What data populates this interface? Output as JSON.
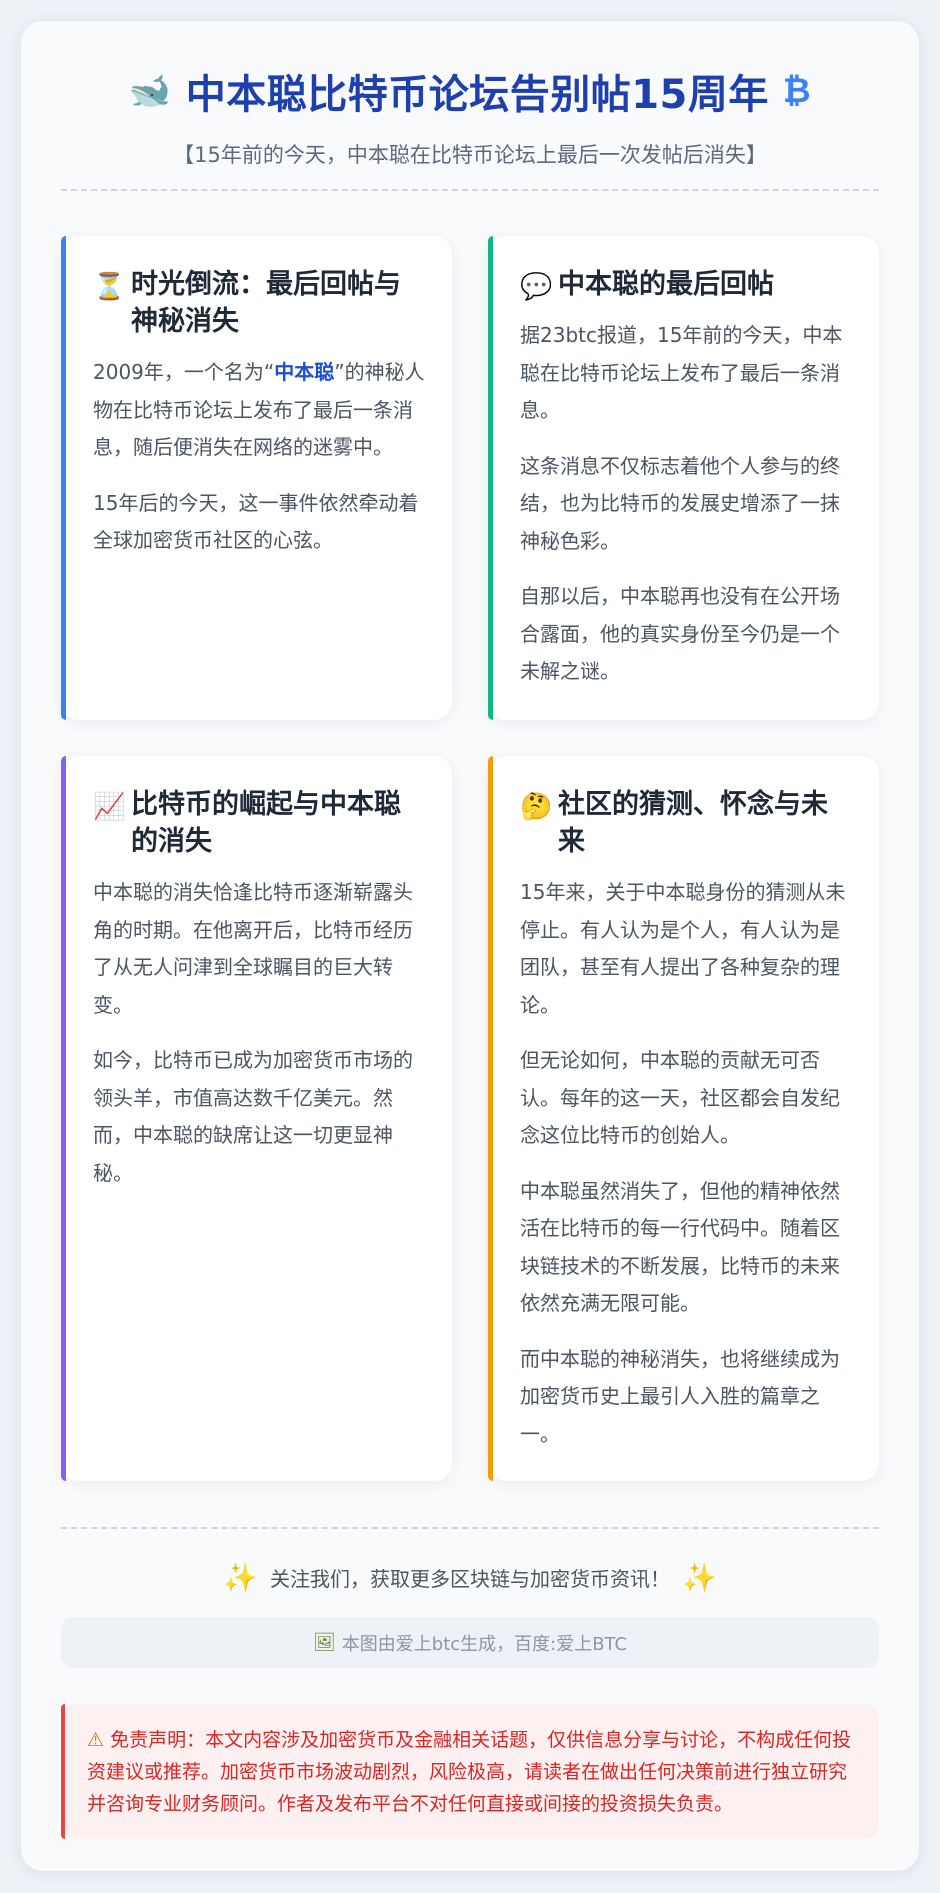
{
  "header": {
    "icon_left": "🐋",
    "icon_right": "₿",
    "title": "中本聪比特币论坛告别帖15周年",
    "subtitle": "【15年前的今天，中本聪在比特币论坛上最后一次发帖后消失】"
  },
  "cards": [
    {
      "icon": "⏳",
      "title": "时光倒流：最后回帖与神秘消失",
      "p1_pre": "2009年，一个名为“",
      "p1_hl": "中本聪",
      "p1_post": "”的神秘人物在比特币论坛上发布了最后一条消息，随后便消失在网络的迷雾中。",
      "p2": "15年后的今天，这一事件依然牵动着全球加密货币社区的心弦。"
    },
    {
      "icon": "💬",
      "title": "中本聪的最后回帖",
      "p1": "据23btc报道，15年前的今天，中本聪在比特币论坛上发布了最后一条消息。",
      "p2": "这条消息不仅标志着他个人参与的终结，也为比特币的发展史增添了一抹神秘色彩。",
      "p3": "自那以后，中本聪再也没有在公开场合露面，他的真实身份至今仍是一个未解之谜。"
    },
    {
      "icon": "📈",
      "title": "比特币的崛起与中本聪的消失",
      "p1": "中本聪的消失恰逢比特币逐渐崭露头角的时期。在他离开后，比特币经历了从无人问津到全球瞩目的巨大转变。",
      "p2": "如今，比特币已成为加密货币市场的领头羊，市值高达数千亿美元。然而，中本聪的缺席让这一切更显神秘。"
    },
    {
      "icon": "🤔",
      "title": "社区的猜测、怀念与未来",
      "p1": "15年来，关于中本聪身份的猜测从未停止。有人认为是个人，有人认为是团队，甚至有人提出了各种复杂的理论。",
      "p2": "但无论如何，中本聪的贡献无可否认。每年的这一天，社区都会自发纪念这位比特币的创始人。",
      "p3": "中本聪虽然消失了，但他的精神依然活在比特币的每一行代码中。随着区块链技术的不断发展，比特币的未来依然充满无限可能。",
      "p4": "而中本聪的神秘消失，也将继续成为加密货币史上最引人入胜的篇章之一。"
    }
  ],
  "footer": {
    "spark_icon": "✨",
    "follow": "关注我们，获取更多区块链与加密货币资讯！",
    "gen_icon": "🖼",
    "generated": "本图由爱上btc生成，百度:爱上BTC",
    "warn_icon": "⚠",
    "disclaimer": "免责声明：本文内容涉及加密货币及金融相关话题，仅供信息分享与讨论，不构成任何投资建议或推荐。加密货币市场波动剧烈，风险极高，请读者在做出任何决策前进行独立研究并咨询专业财务顾问。作者及发布平台不对任何直接或间接的投资损失负责。"
  },
  "colors": {
    "title": "#1e40af",
    "card1_accent": "#3b82f6",
    "card2_accent": "#10b981",
    "card3_accent": "#8b5cf6",
    "card4_accent": "#f59e0b",
    "disclaimer": "#dc2626"
  }
}
